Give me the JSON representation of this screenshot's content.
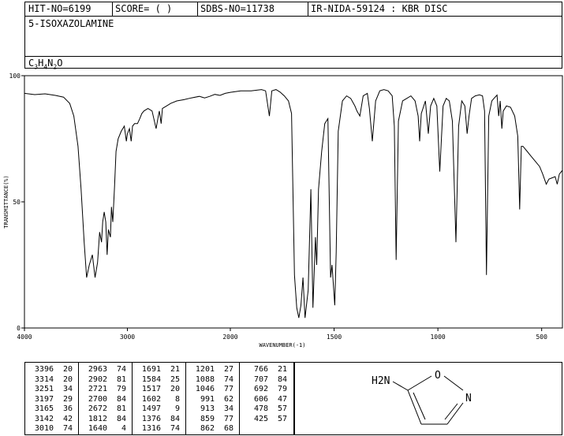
{
  "header": {
    "hit_no": "HIT-NO=6199",
    "score": "SCORE=  (   )",
    "sdbs_no": "SDBS-NO=11738",
    "ir_info": "IR-NIDA-59124 : KBR DISC",
    "compound_name": "5-ISOXAZOLAMINE",
    "formula": {
      "c": "C",
      "c_n": "3",
      "h": "H",
      "h_n": "4",
      "n": "N",
      "n_n": "2",
      "o": "O"
    }
  },
  "chart_data": {
    "type": "line",
    "xlabel": "WAVENUMBER(-1)",
    "ylabel": "TRANSMITTANCE(%)",
    "xlim": [
      4000,
      400
    ],
    "ylim": [
      0,
      100
    ],
    "x_ticks": [
      4000,
      3000,
      2000,
      1500,
      1000,
      500
    ],
    "y_ticks": [
      0,
      50,
      100
    ],
    "series": [
      {
        "points": [
          [
            4000,
            93
          ],
          [
            3900,
            92.5
          ],
          [
            3800,
            92.8
          ],
          [
            3700,
            92.2
          ],
          [
            3620,
            91.5
          ],
          [
            3560,
            89
          ],
          [
            3520,
            84
          ],
          [
            3480,
            72
          ],
          [
            3450,
            55
          ],
          [
            3420,
            34
          ],
          [
            3396,
            20
          ],
          [
            3370,
            25
          ],
          [
            3340,
            29
          ],
          [
            3314,
            20
          ],
          [
            3290,
            26
          ],
          [
            3270,
            38
          ],
          [
            3251,
            34
          ],
          [
            3240,
            42
          ],
          [
            3225,
            46
          ],
          [
            3210,
            42
          ],
          [
            3197,
            29
          ],
          [
            3185,
            39
          ],
          [
            3165,
            36
          ],
          [
            3155,
            48
          ],
          [
            3142,
            42
          ],
          [
            3125,
            56
          ],
          [
            3110,
            70
          ],
          [
            3090,
            75
          ],
          [
            3060,
            78
          ],
          [
            3030,
            80
          ],
          [
            3010,
            74
          ],
          [
            3000,
            77
          ],
          [
            2980,
            79
          ],
          [
            2963,
            74
          ],
          [
            2950,
            80
          ],
          [
            2930,
            81
          ],
          [
            2902,
            81
          ],
          [
            2880,
            83
          ],
          [
            2860,
            85
          ],
          [
            2840,
            86
          ],
          [
            2800,
            87
          ],
          [
            2760,
            86
          ],
          [
            2721,
            79
          ],
          [
            2700,
            84
          ],
          [
            2690,
            86
          ],
          [
            2672,
            81
          ],
          [
            2660,
            87
          ],
          [
            2620,
            88
          ],
          [
            2580,
            89
          ],
          [
            2520,
            90
          ],
          [
            2450,
            90.5
          ],
          [
            2380,
            91.2
          ],
          [
            2300,
            91.8
          ],
          [
            2250,
            91.2
          ],
          [
            2200,
            91.8
          ],
          [
            2150,
            92.6
          ],
          [
            2100,
            92.2
          ],
          [
            2050,
            93
          ],
          [
            2000,
            93.4
          ],
          [
            1950,
            94
          ],
          [
            1900,
            94
          ],
          [
            1850,
            94.5
          ],
          [
            1830,
            94
          ],
          [
            1812,
            84
          ],
          [
            1800,
            94
          ],
          [
            1780,
            94.5
          ],
          [
            1760,
            93.5
          ],
          [
            1740,
            92
          ],
          [
            1720,
            90
          ],
          [
            1705,
            85
          ],
          [
            1691,
            21
          ],
          [
            1680,
            8
          ],
          [
            1670,
            4
          ],
          [
            1660,
            9
          ],
          [
            1650,
            20
          ],
          [
            1640,
            4
          ],
          [
            1625,
            15
          ],
          [
            1612,
            55
          ],
          [
            1602,
            8
          ],
          [
            1590,
            36
          ],
          [
            1584,
            25
          ],
          [
            1575,
            55
          ],
          [
            1560,
            70
          ],
          [
            1545,
            81
          ],
          [
            1530,
            83
          ],
          [
            1517,
            20
          ],
          [
            1510,
            25
          ],
          [
            1497,
            9
          ],
          [
            1490,
            30
          ],
          [
            1480,
            78
          ],
          [
            1460,
            90
          ],
          [
            1440,
            92
          ],
          [
            1420,
            91
          ],
          [
            1400,
            88
          ],
          [
            1390,
            86
          ],
          [
            1376,
            84
          ],
          [
            1360,
            92
          ],
          [
            1340,
            93
          ],
          [
            1330,
            87
          ],
          [
            1316,
            74
          ],
          [
            1300,
            90
          ],
          [
            1280,
            94
          ],
          [
            1260,
            94.5
          ],
          [
            1240,
            94
          ],
          [
            1220,
            92
          ],
          [
            1210,
            80
          ],
          [
            1201,
            27
          ],
          [
            1190,
            82
          ],
          [
            1170,
            90
          ],
          [
            1150,
            91
          ],
          [
            1130,
            92
          ],
          [
            1110,
            90
          ],
          [
            1095,
            84
          ],
          [
            1088,
            74
          ],
          [
            1080,
            85
          ],
          [
            1060,
            90
          ],
          [
            1046,
            77
          ],
          [
            1035,
            88
          ],
          [
            1020,
            91
          ],
          [
            1005,
            88
          ],
          [
            991,
            62
          ],
          [
            975,
            88
          ],
          [
            960,
            91
          ],
          [
            945,
            90
          ],
          [
            930,
            82
          ],
          [
            913,
            34
          ],
          [
            900,
            80
          ],
          [
            885,
            90
          ],
          [
            870,
            88
          ],
          [
            859,
            77
          ],
          [
            850,
            84
          ],
          [
            838,
            91
          ],
          [
            820,
            92
          ],
          [
            800,
            92.4
          ],
          [
            785,
            92
          ],
          [
            775,
            86
          ],
          [
            766,
            21
          ],
          [
            755,
            84
          ],
          [
            740,
            90
          ],
          [
            730,
            91
          ],
          [
            715,
            92.3
          ],
          [
            707,
            84
          ],
          [
            700,
            90
          ],
          [
            692,
            79
          ],
          [
            685,
            86
          ],
          [
            670,
            88
          ],
          [
            650,
            87.5
          ],
          [
            630,
            84
          ],
          [
            615,
            76
          ],
          [
            606,
            47
          ],
          [
            598,
            72
          ],
          [
            590,
            72
          ],
          [
            570,
            70
          ],
          [
            550,
            68
          ],
          [
            530,
            66
          ],
          [
            510,
            64
          ],
          [
            495,
            61
          ],
          [
            478,
            57
          ],
          [
            465,
            59
          ],
          [
            450,
            59.5
          ],
          [
            435,
            60
          ],
          [
            425,
            57
          ],
          [
            415,
            61
          ],
          [
            400,
            62.5
          ]
        ]
      }
    ]
  },
  "peak_table": {
    "columns": [
      [
        [
          "3396",
          "20"
        ],
        [
          "3314",
          "20"
        ],
        [
          "3251",
          "34"
        ],
        [
          "3197",
          "29"
        ],
        [
          "3165",
          "36"
        ],
        [
          "3142",
          "42"
        ],
        [
          "3010",
          "74"
        ]
      ],
      [
        [
          "2963",
          "74"
        ],
        [
          "2902",
          "81"
        ],
        [
          "2721",
          "79"
        ],
        [
          "2700",
          "84"
        ],
        [
          "2672",
          "81"
        ],
        [
          "1812",
          "84"
        ],
        [
          "1640",
          "4"
        ]
      ],
      [
        [
          "1691",
          "21"
        ],
        [
          "1584",
          "25"
        ],
        [
          "1517",
          "20"
        ],
        [
          "1602",
          "8"
        ],
        [
          "1497",
          "9"
        ],
        [
          "1376",
          "84"
        ],
        [
          "1316",
          "74"
        ]
      ],
      [
        [
          "1201",
          "27"
        ],
        [
          "1088",
          "74"
        ],
        [
          "1046",
          "77"
        ],
        [
          "991",
          "62"
        ],
        [
          "913",
          "34"
        ],
        [
          "859",
          "77"
        ],
        [
          "862",
          "68"
        ]
      ],
      [
        [
          "766",
          "21"
        ],
        [
          "707",
          "84"
        ],
        [
          "692",
          "79"
        ],
        [
          "606",
          "47"
        ],
        [
          "478",
          "57"
        ],
        [
          "425",
          "57"
        ]
      ]
    ]
  },
  "structure": {
    "nh2": "H2N",
    "o": "O",
    "n": "N"
  }
}
